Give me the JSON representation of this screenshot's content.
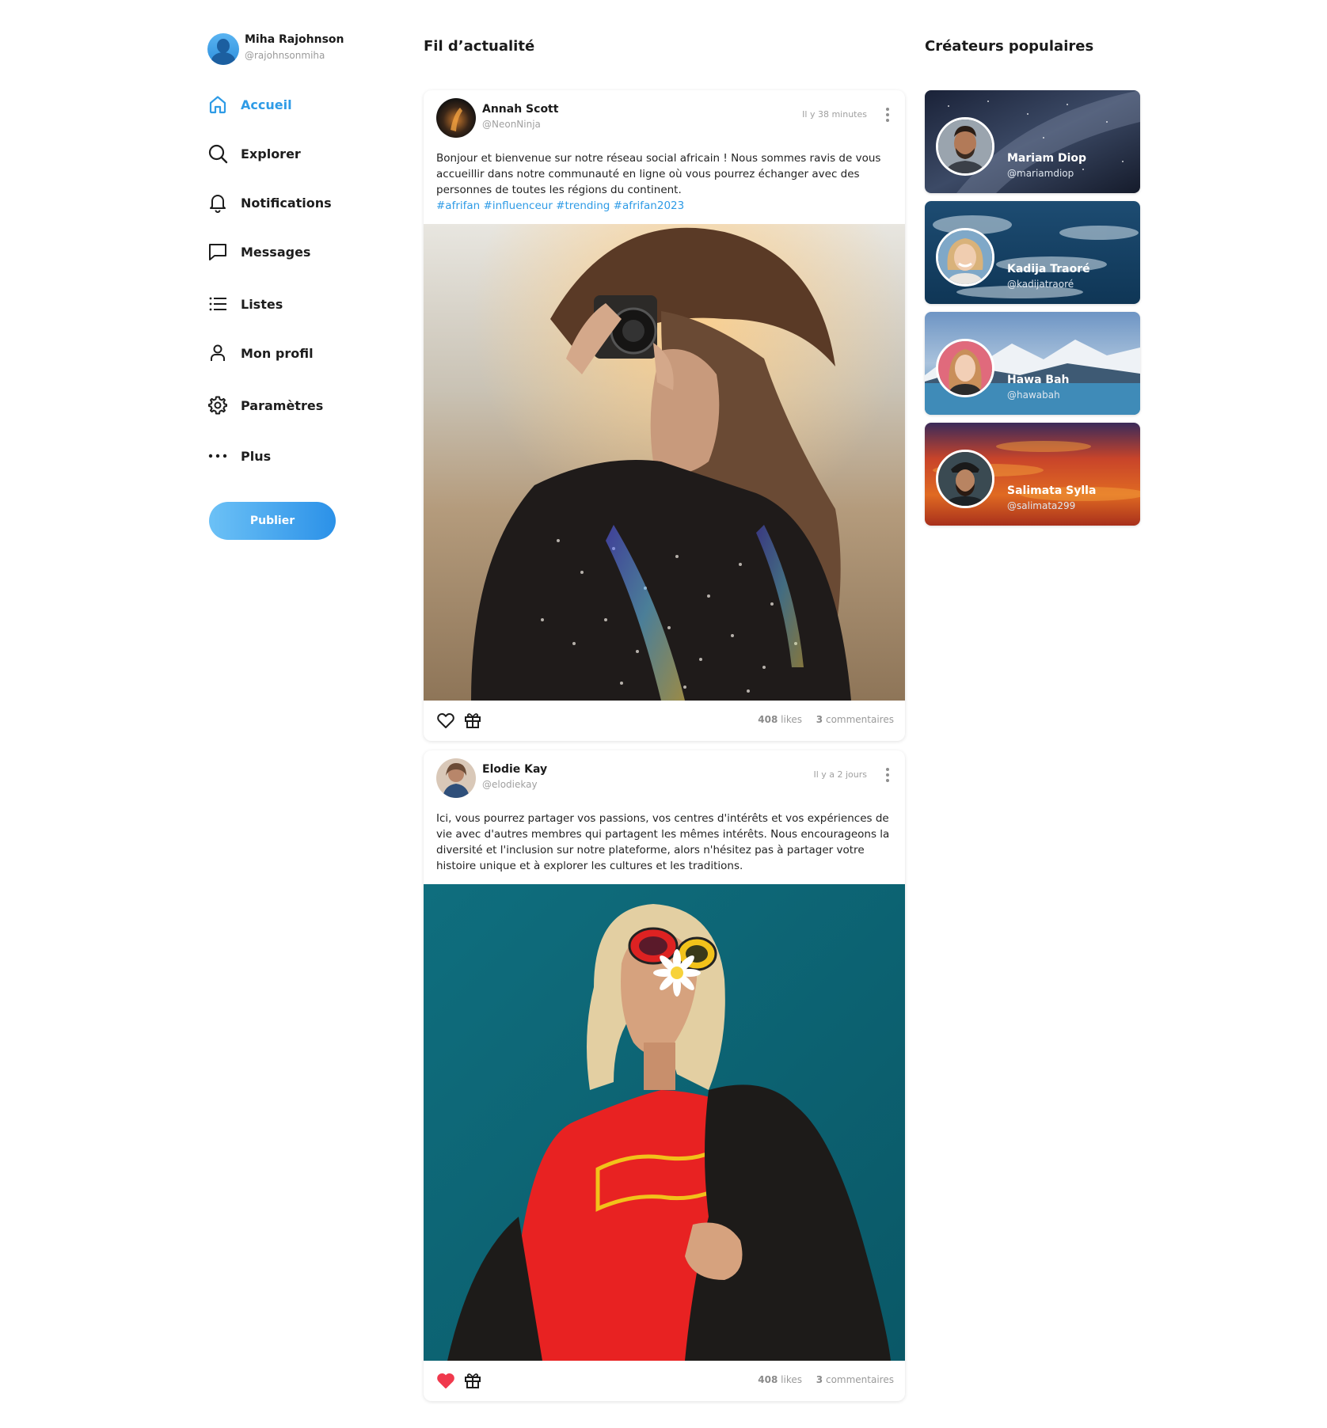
{
  "user": {
    "name": "Miha Rajohnson",
    "handle": "@rajohnsonmiha"
  },
  "nav": [
    {
      "label": "Accueil",
      "icon": "home-icon",
      "active": true
    },
    {
      "label": "Explorer",
      "icon": "search-icon",
      "active": false
    },
    {
      "label": "Notifications",
      "icon": "bell-icon",
      "active": false
    },
    {
      "label": "Messages",
      "icon": "message-icon",
      "active": false
    },
    {
      "label": "Listes",
      "icon": "list-icon",
      "active": false
    },
    {
      "label": "Mon profil",
      "icon": "user-icon",
      "active": false
    },
    {
      "label": "Paramètres",
      "icon": "gear-icon",
      "active": false
    },
    {
      "label": "Plus",
      "icon": "more-dots-icon",
      "active": false
    }
  ],
  "publish_label": "Publier",
  "feed": {
    "title": "Fil d’actualité",
    "posts": [
      {
        "author": "Annah Scott",
        "handle": "@NeonNinja",
        "time": "Il y 38 minutes",
        "text": "Bonjour et bienvenue sur notre réseau social africain ! Nous sommes ravis de vous accueillir dans notre communauté en ligne où vous pourrez échanger avec des personnes de toutes les régions du continent.",
        "tags": "#afrifan #influenceur #trending #afrifan2023",
        "likes_count": "408",
        "likes_label": "likes",
        "comments_count": "3",
        "comments_label": "commentaires",
        "liked": false
      },
      {
        "author": "Elodie Kay",
        "handle": "@elodiekay",
        "time": "Il y a 2 jours",
        "text": "Ici, vous pourrez partager vos passions, vos centres d'intérêts et vos expériences de vie avec d'autres membres qui partagent les mêmes intérêts. Nous encourageons la diversité et l'inclusion sur notre plateforme, alors n'hésitez pas à partager votre histoire unique et à explorer les cultures et les traditions.",
        "tags": "",
        "likes_count": "408",
        "likes_label": "likes",
        "comments_count": "3",
        "comments_label": "commentaires",
        "liked": true
      }
    ]
  },
  "creators": {
    "title": "Créateurs populaires",
    "items": [
      {
        "name": "Mariam Diop",
        "handle": "@mariamdiop"
      },
      {
        "name": "Kadija Traoré",
        "handle": "@kadijatraoré"
      },
      {
        "name": "Hawa Bah",
        "handle": "@hawabah"
      },
      {
        "name": "Salimata Sylla",
        "handle": "@salimata299"
      }
    ]
  },
  "colors": {
    "accent": "#2e9be6",
    "like_active": "#f0394d",
    "text_dark": "#1b1b1b",
    "text_muted": "#9a9a9a"
  }
}
